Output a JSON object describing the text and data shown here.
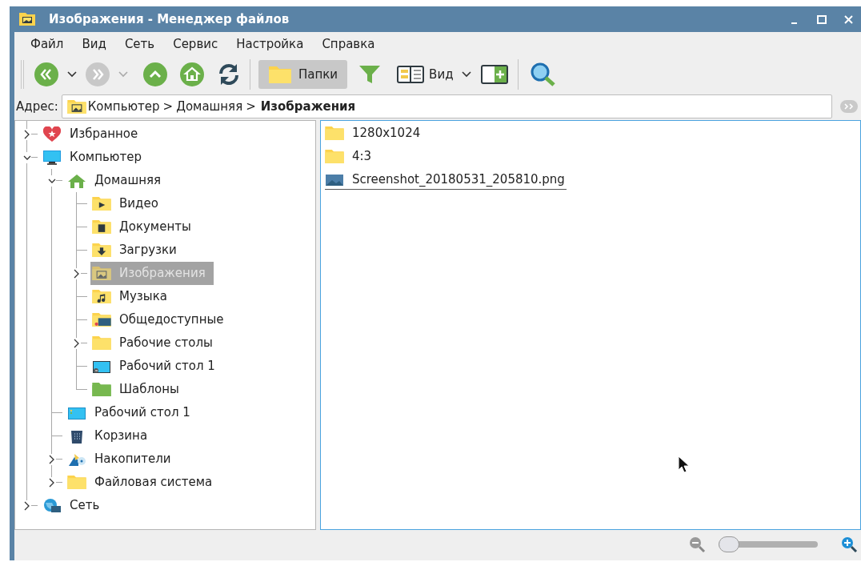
{
  "window": {
    "title": "Изображения - Менеджер файлов"
  },
  "menu": [
    "Файл",
    "Вид",
    "Сеть",
    "Сервис",
    "Настройка",
    "Справка"
  ],
  "toolbar": [
    {
      "kind": "back",
      "disabled": false
    },
    {
      "kind": "dropdown",
      "disabled": false
    },
    {
      "kind": "forward",
      "disabled": true
    },
    {
      "kind": "dropdown",
      "disabled": true
    },
    {
      "kind": "up",
      "disabled": false
    },
    {
      "kind": "home",
      "disabled": false
    },
    {
      "kind": "reload",
      "disabled": false
    },
    {
      "kind": "separator"
    },
    {
      "kind": "folders",
      "label": "Папки",
      "pressed": true
    },
    {
      "kind": "filter",
      "pressed": false
    },
    {
      "kind": "view",
      "label": "Вид"
    },
    {
      "kind": "dropdown",
      "disabled": false
    },
    {
      "kind": "split",
      "pressed": false
    },
    {
      "kind": "separator"
    },
    {
      "kind": "search",
      "pressed": false
    }
  ],
  "address": {
    "label": "Адрес:",
    "parts": [
      {
        "kind": "crumb",
        "label": "Компьютер",
        "current": false
      },
      {
        "kind": "sep",
        "label": ">"
      },
      {
        "kind": "crumb",
        "label": "Домашняя",
        "current": false
      },
      {
        "kind": "sep",
        "label": ">"
      },
      {
        "kind": "crumb",
        "label": "Изображения",
        "current": true
      }
    ]
  },
  "tree": [
    {
      "label": "Избранное",
      "kind": "favorites",
      "expanded": false,
      "selected": false
    },
    {
      "label": "Компьютер",
      "kind": "computer",
      "expanded": true,
      "selected": false,
      "children": [
        {
          "label": "Домашняя",
          "kind": "home",
          "expanded": true,
          "selected": false,
          "children": [
            {
              "label": "Видео",
              "kind": "folder-video",
              "selected": false
            },
            {
              "label": "Документы",
              "kind": "folder-documents",
              "selected": false
            },
            {
              "label": "Загрузки",
              "kind": "folder-downloads",
              "selected": false
            },
            {
              "label": "Изображения",
              "kind": "folder-pictures",
              "expanded": false,
              "selected": true
            },
            {
              "label": "Музыка",
              "kind": "folder-music",
              "selected": false
            },
            {
              "label": "Общедоступные",
              "kind": "folder-public",
              "selected": false
            },
            {
              "label": "Рабочие столы",
              "kind": "folder",
              "expanded": false,
              "selected": false
            },
            {
              "label": "Рабочий стол 1",
              "kind": "desktop-link",
              "selected": false
            },
            {
              "label": "Шаблоны",
              "kind": "folder-templates",
              "selected": false
            }
          ]
        },
        {
          "label": "Рабочий стол 1",
          "kind": "desktop",
          "selected": false
        },
        {
          "label": "Корзина",
          "kind": "trash",
          "selected": false
        },
        {
          "label": "Накопители",
          "kind": "drives",
          "expanded": false,
          "selected": false
        },
        {
          "label": "Файловая система",
          "kind": "folder",
          "expanded": false,
          "selected": false
        }
      ]
    },
    {
      "label": "Сеть",
      "kind": "network",
      "expanded": false,
      "selected": false
    }
  ],
  "files": [
    {
      "name": "1280x1024",
      "kind": "folder",
      "focused": false
    },
    {
      "name": "4:3",
      "kind": "folder",
      "focused": false
    },
    {
      "name": "Screenshot_20180531_205810.png",
      "kind": "image",
      "focused": true
    }
  ],
  "zoom": {
    "level": 0
  }
}
